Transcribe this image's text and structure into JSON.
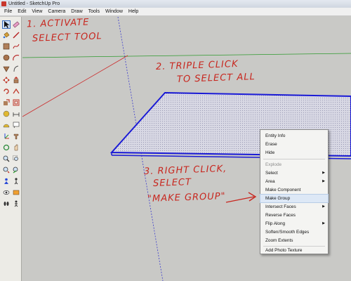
{
  "window": {
    "title": "Untitled - SketchUp Pro"
  },
  "menubar": {
    "items": [
      "File",
      "Edit",
      "View",
      "Camera",
      "Draw",
      "Tools",
      "Window",
      "Help"
    ]
  },
  "annotations": {
    "step1_line1": "1. ACTIVATE",
    "step1_line2": "SELECT TOOL",
    "step2_line1": "2. TRIPLE CLICK",
    "step2_line2": "TO SELECT ALL",
    "step3_line1": "3. RIGHT CLICK,",
    "step3_line2": "SELECT",
    "step3_line3": "\"MAKE GROUP\""
  },
  "context_menu": {
    "items": [
      {
        "label": "Entity Info",
        "submenu": false,
        "disabled": false
      },
      {
        "label": "Erase",
        "submenu": false,
        "disabled": false
      },
      {
        "label": "Hide",
        "submenu": false,
        "disabled": false
      },
      {
        "label": "Explode",
        "submenu": false,
        "disabled": true
      },
      {
        "label": "Select",
        "submenu": true,
        "disabled": false
      },
      {
        "label": "Area",
        "submenu": true,
        "disabled": false
      },
      {
        "label": "Make Component",
        "submenu": false,
        "disabled": false
      },
      {
        "label": "Make Group",
        "submenu": false,
        "disabled": false,
        "highlighted": true
      },
      {
        "label": "Intersect Faces",
        "submenu": true,
        "disabled": false
      },
      {
        "label": "Reverse Faces",
        "submenu": false,
        "disabled": false
      },
      {
        "label": "Flip Along",
        "submenu": true,
        "disabled": false
      },
      {
        "label": "Soften/Smooth Edges",
        "submenu": false,
        "disabled": false
      },
      {
        "label": "Zoom Extents",
        "submenu": false,
        "disabled": false
      },
      {
        "label": "Add Photo Texture",
        "submenu": false,
        "disabled": false
      }
    ],
    "submenu_arrow": "▶"
  },
  "colors": {
    "annotation_red": "#c8261e",
    "selection_blue": "#1a1ad6",
    "axis_red": "#cc2a2a",
    "axis_green": "#2e9a2e",
    "axis_blue": "#3a3acc"
  },
  "icons": {
    "toolbar": [
      "select-arrow-icon",
      "eraser-icon",
      "paint-bucket-icon",
      "pencil-line-icon",
      "rectangle-icon",
      "freehand-icon",
      "circle-icon",
      "arc-icon",
      "polygon-icon",
      "freehand-curve-icon",
      "move-icon",
      "push-pull-icon",
      "rotate-icon",
      "follow-me-icon",
      "scale-icon",
      "offset-icon",
      "tape-measure-icon",
      "dimension-icon",
      "protractor-icon",
      "text-icon",
      "axes-icon",
      "3d-text-icon",
      "orbit-icon",
      "pan-icon",
      "zoom-icon",
      "zoom-window-icon",
      "zoom-extents-icon",
      "previous-view-icon",
      "position-camera-icon",
      "walk-icon",
      "look-around-icon",
      "section-plane-icon",
      "footprint-icon",
      "walk-figure-icon"
    ]
  }
}
